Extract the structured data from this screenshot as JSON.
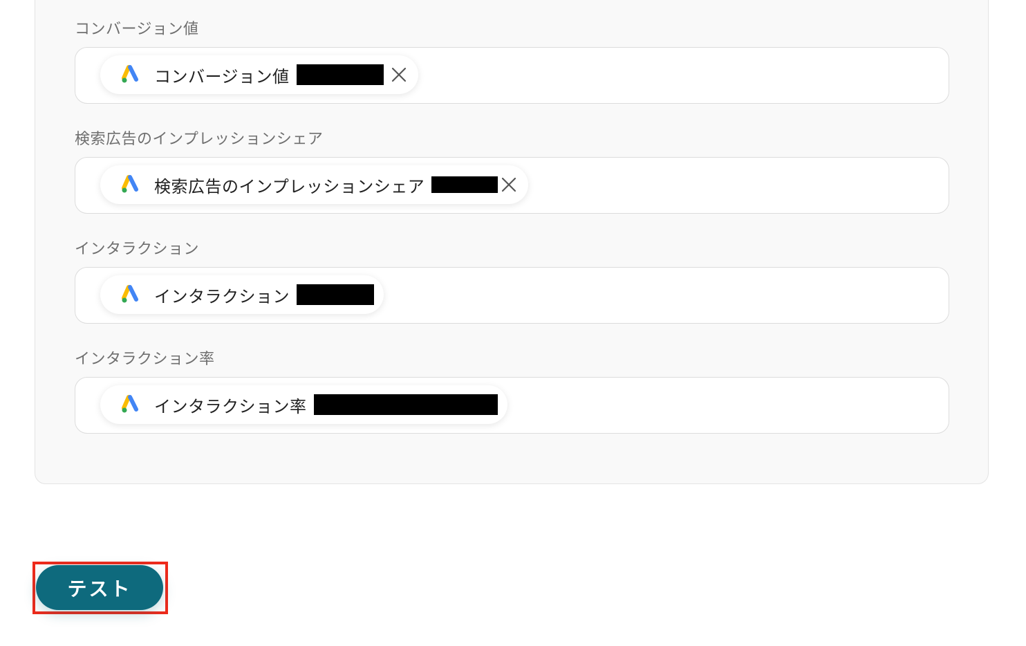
{
  "fields": [
    {
      "label": "コンバージョン値",
      "chip": {
        "app_icon": "google-ads-icon",
        "label": "コンバージョン値",
        "redacted": true,
        "removable": true
      }
    },
    {
      "label": "検索広告のインプレッションシェア",
      "chip": {
        "app_icon": "google-ads-icon",
        "label": "検索広告のインプレッションシェア",
        "redacted": true,
        "removable": true
      }
    },
    {
      "label": "インタラクション",
      "chip": {
        "app_icon": "google-ads-icon",
        "label": "インタラクション",
        "redacted": true,
        "removable": false
      }
    },
    {
      "label": "インタラクション率",
      "chip": {
        "app_icon": "google-ads-icon",
        "label": "インタラクション率",
        "redacted": true,
        "removable": false
      }
    }
  ],
  "actions": {
    "test_label": "テスト"
  },
  "colors": {
    "primary_button": "#0e6a7d",
    "highlight_outline": "#ee2a1b",
    "redaction": "#000000"
  }
}
